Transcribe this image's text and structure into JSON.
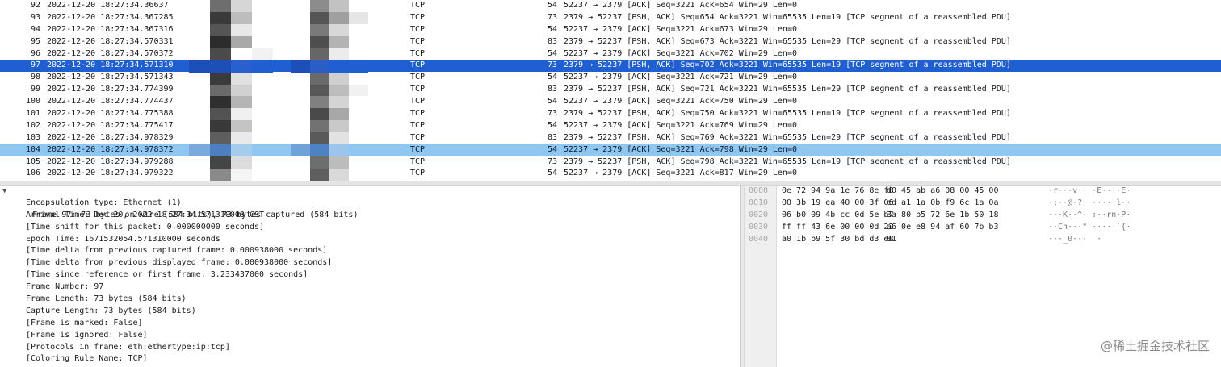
{
  "packets": [
    {
      "no": "92",
      "time": "2022-12-20 18:27:34.36637",
      "proto": "TCP",
      "len": "54",
      "info": "52237 → 2379 [ACK] Seq=3221 Ack=654 Win=29 Len=0"
    },
    {
      "no": "93",
      "time": "2022-12-20 18:27:34.367285",
      "proto": "TCP",
      "len": "73",
      "info": "2379 → 52237 [PSH, ACK] Seq=654 Ack=3221 Win=65535 Len=19 [TCP segment of a reassembled PDU]"
    },
    {
      "no": "94",
      "time": "2022-12-20 18:27:34.367316",
      "proto": "TCP",
      "len": "54",
      "info": "52237 → 2379 [ACK] Seq=3221 Ack=673 Win=29 Len=0"
    },
    {
      "no": "95",
      "time": "2022-12-20 18:27:34.570331",
      "proto": "TCP",
      "len": "83",
      "info": "2379 → 52237 [PSH, ACK] Seq=673 Ack=3221 Win=65535 Len=29 [TCP segment of a reassembled PDU]"
    },
    {
      "no": "96",
      "time": "2022-12-20 18:27:34.570372",
      "proto": "TCP",
      "len": "54",
      "info": "52237 → 2379 [ACK] Seq=3221 Ack=702 Win=29 Len=0"
    },
    {
      "no": "97",
      "time": "2022-12-20 18:27:34.571310",
      "proto": "TCP",
      "len": "73",
      "info": "2379 → 52237 [PSH, ACK] Seq=702 Ack=3221 Win=65535 Len=19 [TCP segment of a reassembled PDU]"
    },
    {
      "no": "98",
      "time": "2022-12-20 18:27:34.571343",
      "proto": "TCP",
      "len": "54",
      "info": "52237 → 2379 [ACK] Seq=3221 Ack=721 Win=29 Len=0"
    },
    {
      "no": "99",
      "time": "2022-12-20 18:27:34.774399",
      "proto": "TCP",
      "len": "83",
      "info": "2379 → 52237 [PSH, ACK] Seq=721 Ack=3221 Win=65535 Len=29 [TCP segment of a reassembled PDU]"
    },
    {
      "no": "100",
      "time": "2022-12-20 18:27:34.774437",
      "proto": "TCP",
      "len": "54",
      "info": "52237 → 2379 [ACK] Seq=3221 Ack=750 Win=29 Len=0"
    },
    {
      "no": "101",
      "time": "2022-12-20 18:27:34.775388",
      "proto": "TCP",
      "len": "73",
      "info": "2379 → 52237 [PSH, ACK] Seq=750 Ack=3221 Win=65535 Len=19 [TCP segment of a reassembled PDU]"
    },
    {
      "no": "102",
      "time": "2022-12-20 18:27:34.775417",
      "proto": "TCP",
      "len": "54",
      "info": "52237 → 2379 [ACK] Seq=3221 Ack=769 Win=29 Len=0"
    },
    {
      "no": "103",
      "time": "2022-12-20 18:27:34.978329",
      "proto": "TCP",
      "len": "83",
      "info": "2379 → 52237 [PSH, ACK] Seq=769 Ack=3221 Win=65535 Len=29 [TCP segment of a reassembled PDU]"
    },
    {
      "no": "104",
      "time": "2022-12-20 18:27:34.978372",
      "proto": "TCP",
      "len": "54",
      "info": "52237 → 2379 [ACK] Seq=3221 Ack=798 Win=29 Len=0"
    },
    {
      "no": "105",
      "time": "2022-12-20 18:27:34.979288",
      "proto": "TCP",
      "len": "73",
      "info": "2379 → 52237 [PSH, ACK] Seq=798 Ack=3221 Win=65535 Len=19 [TCP segment of a reassembled PDU]"
    },
    {
      "no": "106",
      "time": "2022-12-20 18:27:34.979322",
      "proto": "TCP",
      "len": "54",
      "info": "52237 → 2379 [ACK] Seq=3221 Ack=817 Win=29 Len=0"
    }
  ],
  "selected_packet": "97",
  "marked_packet": "104",
  "mosaic_tones": {
    "src": [
      "#ffffff",
      "#6e6e6e",
      "#d6d6d6",
      "#ffffff",
      "#ffffff",
      "#3a3a3a",
      "#bdbdbd",
      "#ffffff",
      "#ffffff",
      "#555555",
      "#e8e8e8",
      "#ffffff",
      "#ffffff",
      "#2c2c2c",
      "#a9a9a9",
      "#ffffff",
      "#ffffff",
      "#4a4a4a",
      "#ffffff",
      "#f2f2f2",
      "#1e4fb8",
      "#1e4fb8",
      "#2a5fd0",
      "#1f5fd1",
      "#ffffff",
      "#3b3b3b",
      "#e0e0e0",
      "#ffffff",
      "#ffffff",
      "#6a6a6a",
      "#d0d0d0",
      "#ffffff",
      "#ffffff",
      "#2e2e2e",
      "#b5b5b5",
      "#ffffff",
      "#ffffff",
      "#525252",
      "#f0f0f0",
      "#ffffff",
      "#ffffff",
      "#393939",
      "#c4c4c4",
      "#ffffff",
      "#ffffff",
      "#5e5e5e",
      "#eaeaea",
      "#ffffff",
      "#7aa9dd",
      "#4b7fc0",
      "#a5cbed",
      "#8fc7f3",
      "#ffffff",
      "#454545",
      "#dcdcdc",
      "#ffffff",
      "#ffffff",
      "#8a8a8a",
      "#f5f5f5",
      "#ffffff"
    ],
    "dst": [
      "#ffffff",
      "#8c8c8c",
      "#c2c2c2",
      "#ffffff",
      "#ffffff",
      "#555555",
      "#a0a0a0",
      "#e6e6e6",
      "#ffffff",
      "#7a7a7a",
      "#d8d8d8",
      "#ffffff",
      "#ffffff",
      "#4e4e4e",
      "#b3b3b3",
      "#ffffff",
      "#ffffff",
      "#666666",
      "#ececec",
      "#ffffff",
      "#1e4fb8",
      "#2c5cc6",
      "#1f5fd1",
      "#1f5fd1",
      "#ffffff",
      "#6b6b6b",
      "#cfcfcf",
      "#ffffff",
      "#ffffff",
      "#585858",
      "#bdbdbd",
      "#f2f2f2",
      "#ffffff",
      "#808080",
      "#d4d4d4",
      "#ffffff",
      "#ffffff",
      "#4a4a4a",
      "#a8a8a8",
      "#ffffff",
      "#ffffff",
      "#727272",
      "#c9c9c9",
      "#ffffff",
      "#ffffff",
      "#5a5a5a",
      "#e2e2e2",
      "#ffffff",
      "#6fa2da",
      "#4d82c4",
      "#9ac5ec",
      "#8fc7f3",
      "#ffffff",
      "#6e6e6e",
      "#bcbcbc",
      "#ffffff",
      "#ffffff",
      "#5f5f5f",
      "#d9d9d9",
      "#ffffff"
    ]
  },
  "details": {
    "frame_summary": "Frame 97: 73 bytes on wire (584 bits), 73 bytes captured (584 bits)",
    "lines": [
      "Encapsulation type: Ethernet (1)",
      "Arrival Time: Dec 20, 2022 18:27:34.571310000 CST",
      "[Time shift for this packet: 0.000000000 seconds]",
      "Epoch Time: 1671532054.571310000 seconds",
      "[Time delta from previous captured frame: 0.000938000 seconds]",
      "[Time delta from previous displayed frame: 0.000938000 seconds]",
      "[Time since reference or first frame: 3.233437000 seconds]",
      "Frame Number: 97",
      "Frame Length: 73 bytes (584 bits)",
      "Capture Length: 73 bytes (584 bits)",
      "[Frame is marked: False]",
      "[Frame is ignored: False]",
      "[Protocols in frame: eth:ethertype:ip:tcp]",
      "[Coloring Rule Name: TCP]"
    ]
  },
  "hex": [
    {
      "offset": "0000",
      "b1": "0e 72 94 9a 1e 76 8e f8",
      "b2": "d0 45 ab a6 08 00 45 00",
      "ascii": "·r···v·· ·E····E·"
    },
    {
      "offset": "0010",
      "b1": "00 3b 19 ea 40 00 3f 06",
      "b2": "ed a1 1a 0b f9 6c 1a 0a",
      "ascii": "·;··@·?· ·····l··"
    },
    {
      "offset": "0020",
      "b1": "06 b0 09 4b cc 0d 5e b7",
      "b2": "3a 80 b5 72 6e 1b 50 18",
      "ascii": "···K··^· :··rn·P·"
    },
    {
      "offset": "0030",
      "b1": "ff ff 43 6e 00 00 0d 22",
      "b2": "a6 0e e8 94 af 60 7b b3",
      "ascii": "··Cn···\" ·····`{·"
    },
    {
      "offset": "0040",
      "b1": "a0 1b b9 5f 30 bd d3 e8",
      "b2": "81",
      "ascii": "···_0···  ·"
    }
  ],
  "watermark": "@稀土掘金技术社区"
}
